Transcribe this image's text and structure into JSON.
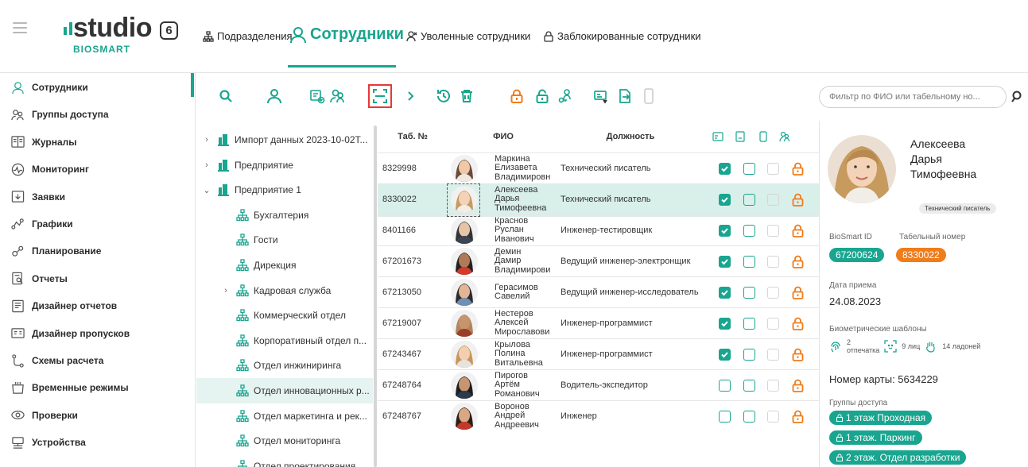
{
  "app": {
    "logo_text": "studio",
    "logo_version": "6",
    "logo_sub": "BIOSMART",
    "accent_color": "#19a58f",
    "warning_color": "#f07c1a"
  },
  "tabs": [
    {
      "label": "Подразделения",
      "icon": "hierarchy-icon"
    },
    {
      "label": "Сотрудники",
      "icon": "person-icon",
      "active": true
    },
    {
      "label": "Уволенные сотрудники",
      "icon": "person-off-icon"
    },
    {
      "label": "Заблокированные сотрудники",
      "icon": "lock-icon"
    }
  ],
  "sidebar": {
    "items": [
      {
        "label": "Сотрудники",
        "icon": "person-icon",
        "active": true
      },
      {
        "label": "Группы доступа",
        "icon": "group-access-icon"
      },
      {
        "label": "Журналы",
        "icon": "journal-icon"
      },
      {
        "label": "Мониторинг",
        "icon": "monitoring-icon"
      },
      {
        "label": "Заявки",
        "icon": "requests-icon"
      },
      {
        "label": "Графики",
        "icon": "schedules-icon"
      },
      {
        "label": "Планирование",
        "icon": "planning-icon"
      },
      {
        "label": "Отчеты",
        "icon": "reports-icon"
      },
      {
        "label": "Дизайнер отчетов",
        "icon": "report-designer-icon"
      },
      {
        "label": "Дизайнер пропусков",
        "icon": "pass-designer-icon"
      },
      {
        "label": "Схемы расчета",
        "icon": "calc-scheme-icon"
      },
      {
        "label": "Временные режимы",
        "icon": "time-modes-icon"
      },
      {
        "label": "Проверки",
        "icon": "checks-icon"
      },
      {
        "label": "Устройства",
        "icon": "devices-icon"
      }
    ]
  },
  "toolbar": {
    "filter_placeholder": "Фильтр по ФИО или табельному но..."
  },
  "tree": [
    {
      "label": "Импорт данных 2023-10-02T...",
      "level": 0,
      "chevron": "›",
      "type": "building"
    },
    {
      "label": "Предприятие",
      "level": 0,
      "chevron": "›",
      "type": "building"
    },
    {
      "label": "Предприятие 1",
      "level": 0,
      "chevron": "⌄",
      "type": "building"
    },
    {
      "label": "Бухгалтерия",
      "level": 1,
      "chevron": "",
      "type": "dept"
    },
    {
      "label": "Гости",
      "level": 1,
      "chevron": "",
      "type": "dept"
    },
    {
      "label": "Дирекция",
      "level": 1,
      "chevron": "",
      "type": "dept"
    },
    {
      "label": "Кадровая служба",
      "level": 1,
      "chevron": "›",
      "type": "dept"
    },
    {
      "label": "Коммерческий отдел",
      "level": 1,
      "chevron": "",
      "type": "dept"
    },
    {
      "label": "Корпоративный отдел п...",
      "level": 1,
      "chevron": "",
      "type": "dept"
    },
    {
      "label": "Отдел инжиниринга",
      "level": 1,
      "chevron": "",
      "type": "dept"
    },
    {
      "label": "Отдел инновационных р...",
      "level": 1,
      "chevron": "",
      "type": "dept",
      "selected": true
    },
    {
      "label": "Отдел маркетинга и рек...",
      "level": 1,
      "chevron": "",
      "type": "dept"
    },
    {
      "label": "Отдел мониторинга",
      "level": 1,
      "chevron": "",
      "type": "dept"
    },
    {
      "label": "Отдел проектирования",
      "level": 1,
      "chevron": "",
      "type": "dept"
    }
  ],
  "table": {
    "headers": {
      "tab": "Таб. №",
      "fio": "ФИО",
      "position": "Должность"
    },
    "rows": [
      {
        "tab": "8329998",
        "fio": [
          "Маркина",
          "Елизавета",
          "Владимировн"
        ],
        "position": "Технический писатель",
        "c1": true,
        "c2": false,
        "avatar": "woman-dark-hair"
      },
      {
        "tab": "8330022",
        "fio": [
          "Алексеева",
          "Дарья",
          "Тимофеевна"
        ],
        "position": "Технический писатель",
        "c1": true,
        "c2": false,
        "avatar": "woman-blonde",
        "selected": true
      },
      {
        "tab": "8401166",
        "fio": [
          "Краснов",
          "Руслан",
          "Иванович"
        ],
        "position": "Инженер-тестировщик",
        "c1": true,
        "c2": false,
        "avatar": "man-suit"
      },
      {
        "tab": "67201673",
        "fio": [
          "Демин",
          "Дамир",
          "Владимирови"
        ],
        "position": "Ведущий инженер-электронщик",
        "c1": true,
        "c2": false,
        "avatar": "man-red-shirt"
      },
      {
        "tab": "67213050",
        "fio": [
          "Герасимов",
          "Савелий"
        ],
        "position": "Ведущий инженер-исследователь",
        "c1": true,
        "c2": false,
        "avatar": "man-smiling"
      },
      {
        "tab": "67219007",
        "fio": [
          "Нестеров",
          "Алексей",
          "Мирославови"
        ],
        "position": "Инженер-программист",
        "c1": true,
        "c2": false,
        "avatar": "man-bald"
      },
      {
        "tab": "67243467",
        "fio": [
          "Крылова",
          "Полина",
          "Витальевна"
        ],
        "position": "Инженер-программист",
        "c1": true,
        "c2": false,
        "avatar": "woman-curly"
      },
      {
        "tab": "67248764",
        "fio": [
          "Пирогов",
          "Артём",
          "Романович"
        ],
        "position": "Водитель-экспедитор",
        "c1": false,
        "c2": false,
        "avatar": "man-dark"
      },
      {
        "tab": "67248767",
        "fio": [
          "Воронов",
          "Андрей",
          "Андреевич"
        ],
        "position": "Инженер",
        "c1": false,
        "c2": false,
        "avatar": "man-beard"
      }
    ]
  },
  "detail": {
    "name": [
      "Алексеева",
      "Дарья",
      "Тимофеевна"
    ],
    "position_badge": "Технический писатель",
    "biosmart_id_label": "BioSmart ID",
    "biosmart_id": "67200624",
    "tab_label": "Табельный номер",
    "tab_number": "8330022",
    "hire_label": "Дата приема",
    "hire_date": "24.08.2023",
    "biometric_label": "Биометрические шаблоны",
    "fingerprint_count": "2",
    "fingerprint_unit": "отпечатка",
    "face_text": "9 лиц",
    "palm_text": "14 ладоней",
    "card_text": "Номер карты: 5634229",
    "groups_label": "Группы доступа",
    "groups": [
      "1 этаж Проходная",
      "1 этаж. Паркинг",
      "2 этаж. Отдел разработки"
    ]
  }
}
